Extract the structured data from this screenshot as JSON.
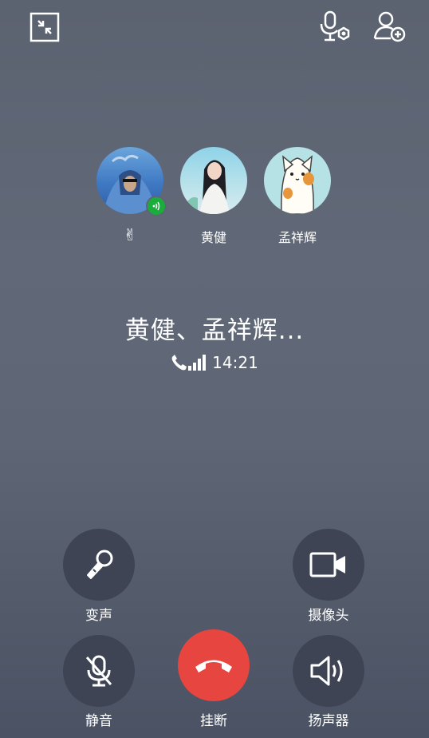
{
  "top_bar": {
    "minimize_icon": "minimize-icon",
    "voice_settings_icon": "mic-settings-icon",
    "add_member_icon": "add-member-icon"
  },
  "participants": [
    {
      "label": "✌",
      "speaking": true,
      "avatar": "blue-blanket-photo"
    },
    {
      "label": "黄健",
      "speaking": false,
      "avatar": "girl-photo"
    },
    {
      "label": "孟祥辉",
      "speaking": false,
      "avatar": "cat-cartoon"
    }
  ],
  "call": {
    "title": "黄健、孟祥辉...",
    "duration": "14:21",
    "signal_icon": "phone-signal-icon"
  },
  "controls": {
    "voice_change": "变声",
    "camera": "摄像头",
    "mute": "静音",
    "hang_up": "挂断",
    "speaker": "扬声器"
  },
  "colors": {
    "hang_up": "#e6463f",
    "button_bg": "#3e4454",
    "speaking_badge": "#1aad3b"
  }
}
